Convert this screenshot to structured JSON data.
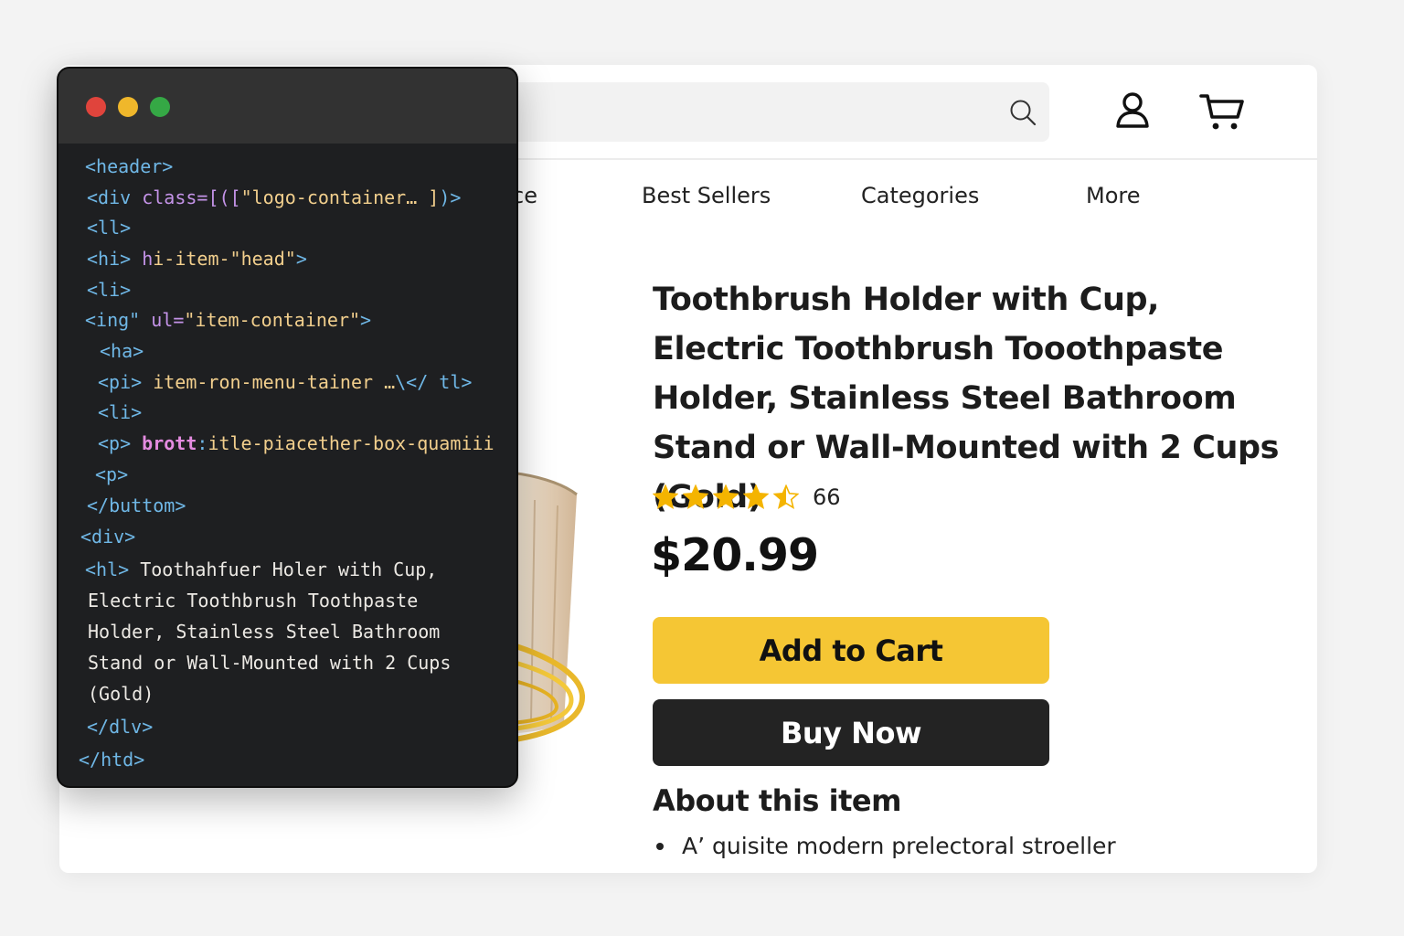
{
  "nav": {
    "items": [
      {
        "label": "ce"
      },
      {
        "label": "Best Sellers"
      },
      {
        "label": "Categories"
      },
      {
        "label": "More"
      }
    ]
  },
  "product": {
    "title": "Toothbrush Holder with Cup, Electric Toothbrush Tooothpaste Holder, Stainless Steel Bathroom Stand or Wall-Mounted with 2 Cups (Gold)",
    "rating_value": 4.5,
    "rating_count": "66",
    "price": "$20.99",
    "add_to_cart_label": "Add to Cart",
    "buy_now_label": "Buy Now",
    "about_heading": "About this item",
    "bullets": [
      "A’ quisite modern prelectoral stroeller"
    ]
  },
  "colors": {
    "accent_yellow": "#f5c634",
    "buy_button": "#232323",
    "star": "#f4b400",
    "window_red": "#e0443c",
    "window_yellow": "#efb72b",
    "window_green": "#35a845"
  },
  "icons": {
    "search": "search-icon",
    "account": "user-icon",
    "cart": "cart-icon"
  },
  "code": {
    "lines": [
      [
        {
          "t": "tag",
          "s": "<header>"
        }
      ],
      [
        {
          "t": "tag",
          "s": "<div "
        },
        {
          "t": "attr",
          "s": "class=[(["
        },
        {
          "t": "str",
          "s": "\"logo-container… ]"
        },
        {
          "t": "tag",
          "s": ")>"
        }
      ],
      [
        {
          "t": "tag",
          "s": "<ll>"
        }
      ],
      [
        {
          "t": "tag",
          "s": "<hi> "
        },
        {
          "t": "attr",
          "s": "h"
        },
        {
          "t": "str",
          "s": "i-item-\"head\""
        },
        {
          "t": "tag",
          "s": ">"
        }
      ],
      [
        {
          "t": "tag",
          "s": "<li>"
        }
      ],
      [
        {
          "t": "tag",
          "s": "<ing\" "
        },
        {
          "t": "attr",
          "s": "ul="
        },
        {
          "t": "str",
          "s": "\"item-container\""
        },
        {
          "t": "tag",
          "s": ">"
        }
      ],
      [
        {
          "t": "tag",
          "s": "<ha>"
        }
      ],
      [
        {
          "t": "tag",
          "s": "<pi> "
        },
        {
          "t": "str",
          "s": "item-ron-menu-tainer …"
        },
        {
          "t": "tag",
          "s": "\\</ tl>"
        }
      ],
      [
        {
          "t": "tag",
          "s": "<li>"
        }
      ],
      [
        {
          "t": "tag",
          "s": "<p> "
        },
        {
          "t": "kw",
          "s": "brott"
        },
        {
          "t": "tag",
          "s": ":"
        },
        {
          "t": "str",
          "s": "itle-piacether-box-quamiii"
        }
      ],
      [
        {
          "t": "tag",
          "s": "<p>"
        }
      ],
      [
        {
          "t": "tag",
          "s": "</buttom>"
        }
      ],
      [
        {
          "t": "tag",
          "s": "<div>"
        }
      ],
      [
        {
          "t": "tag",
          "s": "<hl> "
        },
        {
          "t": "txt",
          "s": "Toothahfuer Holer with Cup,"
        }
      ],
      [
        {
          "t": "txt",
          "s": "Electric Toothbrush Toothpaste"
        }
      ],
      [
        {
          "t": "txt",
          "s": "Holder, Stainless Steel Bathroom"
        }
      ],
      [
        {
          "t": "txt",
          "s": "Stand or Wall-Mounted with 2 Cups"
        }
      ],
      [
        {
          "t": "txt",
          "s": "(Gold)"
        }
      ],
      [
        {
          "t": "tag",
          "s": "</dlv>"
        }
      ],
      [
        {
          "t": "tag",
          "s": "</htd>"
        }
      ]
    ]
  }
}
